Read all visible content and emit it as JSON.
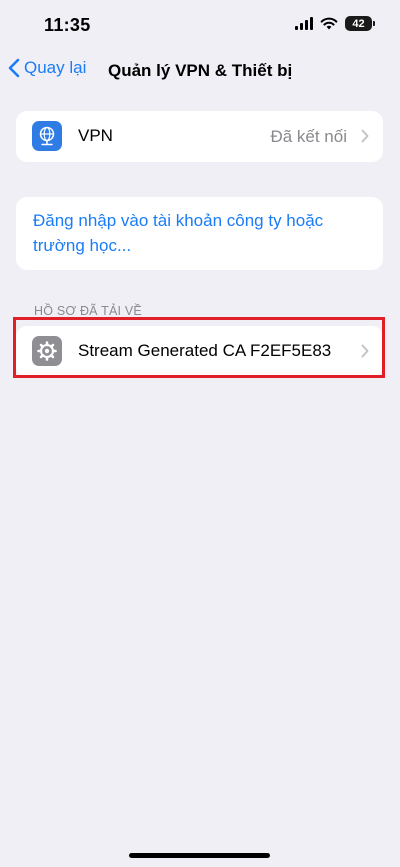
{
  "status_bar": {
    "time": "11:35",
    "battery": "42"
  },
  "nav": {
    "back_label": "Quay lại",
    "title": "Quản lý VPN & Thiết bị"
  },
  "vpn_row": {
    "label": "VPN",
    "value": "Đã kết nối"
  },
  "login_row": {
    "text": "Đăng nhập vào tài khoản công ty hoặc trường học..."
  },
  "profiles_section": {
    "header": "HỒ SƠ ĐÃ TẢI VỀ",
    "items": [
      {
        "label": "Stream Generated CA F2EF5E83",
        "icon": "gear-icon"
      }
    ]
  },
  "colors": {
    "accent": "#1a7cf6",
    "highlight": "#e11f26",
    "background": "#f0eff5"
  }
}
